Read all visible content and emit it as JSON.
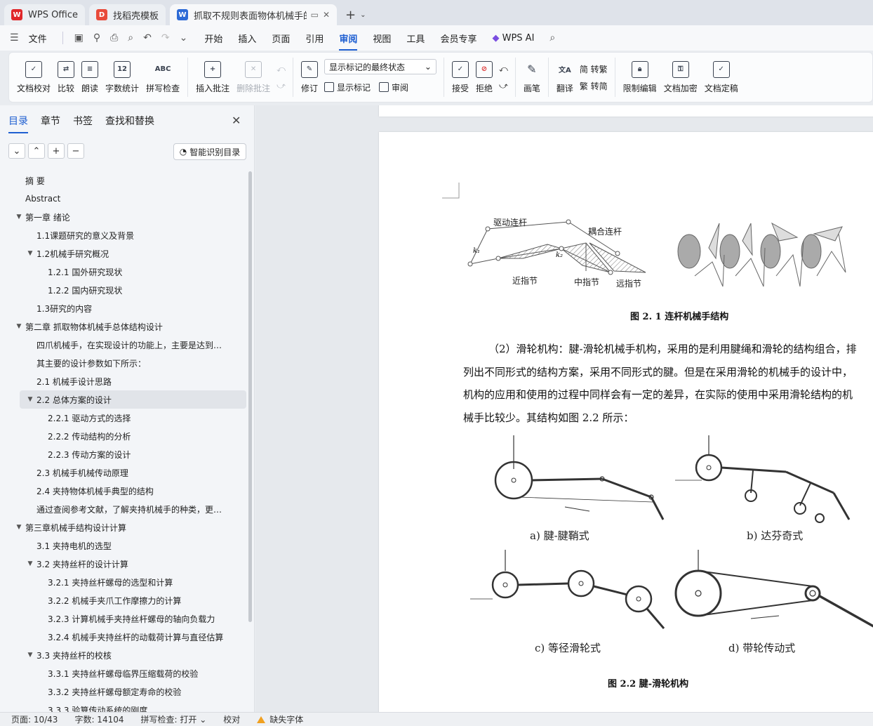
{
  "tabs": [
    {
      "label": "WPS Office",
      "active": false
    },
    {
      "label": "找稻壳模板",
      "active": false
    },
    {
      "label": "抓取不规则表面物体机械手的设计",
      "active": true
    }
  ],
  "menu": {
    "file": "文件",
    "items": [
      "开始",
      "插入",
      "页面",
      "引用",
      "审阅",
      "视图",
      "工具",
      "会员专享"
    ],
    "active": "审阅",
    "ai": "WPS AI"
  },
  "ribbon": {
    "proofread": "文档校对",
    "compare": "比较",
    "read_aloud": "朗读",
    "word_count": "字数统计",
    "spell_check": "拼写检查",
    "insert_comment": "插入批注",
    "delete_comment": "删除批注",
    "track_changes": "修订",
    "markup_mode": "显示标记的最终状态",
    "show_markup": "显示标记",
    "review": "审阅",
    "accept": "接受",
    "reject": "拒绝",
    "pen": "画笔",
    "translate": "翻译",
    "to_traditional": "简 转繁",
    "to_simplified": "繁 转简",
    "restrict_edit": "限制编辑",
    "encrypt": "文档加密",
    "finalize": "文档定稿"
  },
  "nav": {
    "tabs": [
      "目录",
      "章节",
      "书签",
      "查找和替换"
    ],
    "smart_toc": "智能识别目录",
    "toc": [
      {
        "text": "摘 要",
        "level": 1,
        "arrow": ""
      },
      {
        "text": "Abstract",
        "level": 1,
        "arrow": ""
      },
      {
        "text": "第一章 绪论",
        "level": 1,
        "arrow": "▼"
      },
      {
        "text": "1.1课题研究的意义及背景",
        "level": 2,
        "arrow": ""
      },
      {
        "text": "1.2机械手研究概况",
        "level": 2,
        "arrow": "▼"
      },
      {
        "text": "1.2.1 国外研究现状",
        "level": 3,
        "arrow": ""
      },
      {
        "text": "1.2.2 国内研究现状",
        "level": 3,
        "arrow": ""
      },
      {
        "text": "1.3研究的内容",
        "level": 2,
        "arrow": ""
      },
      {
        "text": "第二章 抓取物体机械手总体结构设计",
        "level": 1,
        "arrow": "▼"
      },
      {
        "text": "四爪机械手，在实现设计的功能上，主要是达到夹持...",
        "level": 2,
        "arrow": ""
      },
      {
        "text": "其主要的设计参数如下所示：",
        "level": 2,
        "arrow": ""
      },
      {
        "text": "2.1 机械手设计思路",
        "level": 2,
        "arrow": ""
      },
      {
        "text": "2.2 总体方案的设计",
        "level": 2,
        "arrow": "▼",
        "selected": true
      },
      {
        "text": "2.2.1 驱动方式的选择",
        "level": 3,
        "arrow": ""
      },
      {
        "text": "2.2.2 传动结构的分析",
        "level": 3,
        "arrow": ""
      },
      {
        "text": "2.2.3 传动方案的设计",
        "level": 3,
        "arrow": ""
      },
      {
        "text": "2.3 机械手机械传动原理",
        "level": 2,
        "arrow": ""
      },
      {
        "text": "2.4 夹持物体机械手典型的结构",
        "level": 2,
        "arrow": ""
      },
      {
        "text": "通过查阅参考文献，了解夹持机械手的种类，更好的...",
        "level": 2,
        "arrow": ""
      },
      {
        "text": "第三章机械手结构设计计算",
        "level": 1,
        "arrow": "▼"
      },
      {
        "text": "3.1 夹持电机的选型",
        "level": 2,
        "arrow": ""
      },
      {
        "text": "3.2 夹持丝杆的设计计算",
        "level": 2,
        "arrow": "▼"
      },
      {
        "text": "3.2.1 夹持丝杆螺母的选型和计算",
        "level": 3,
        "arrow": ""
      },
      {
        "text": "3.2.2 机械手夹爪工作摩擦力的计算",
        "level": 3,
        "arrow": ""
      },
      {
        "text": "3.2.3 计算机械手夹持丝杆螺母的轴向负载力",
        "level": 3,
        "arrow": ""
      },
      {
        "text": "3.2.4 机械手夹持丝杆的动载荷计算与直径估算",
        "level": 3,
        "arrow": ""
      },
      {
        "text": "3.3  夹持丝杆的校核",
        "level": 2,
        "arrow": "▼"
      },
      {
        "text": "3.3.1 夹持丝杆螺母临界压缩载荷的校验",
        "level": 3,
        "arrow": ""
      },
      {
        "text": "3.3.2 夹持丝杆螺母额定寿命的校验",
        "level": 3,
        "arrow": ""
      },
      {
        "text": "3.3.3 验算传动系统的刚度",
        "level": 3,
        "arrow": ""
      }
    ]
  },
  "doc": {
    "fig1": {
      "labels": {
        "drive_link": "驱动连杆",
        "coupling_link": "耦合连杆",
        "proximal": "近指节",
        "middle": "中指节",
        "distal": "远指节",
        "k1": "k₁",
        "k2": "k₂"
      },
      "caption": "图 2. 1  连杆机械手结构"
    },
    "paragraph": [
      "（2）滑轮机构：腱-滑轮机械手机构，采用的是利用腱绳和滑轮的结构组合，排",
      "列出不同形式的结构方案，采用不同形式的腱。但是在采用滑轮的机械手的设计中，",
      "机构的应用和使用的过程中同样会有一定的差异，在实际的使用中采用滑轮结构的机",
      "械手比较少。其结构如图  2.2  所示："
    ],
    "fig2": {
      "sub_a": "a)  腱-腱鞘式",
      "sub_b": "b)  达芬奇式",
      "sub_c": "c)  等径滑轮式",
      "sub_d": "d)  带轮传动式",
      "caption": "图  2.2  腱-滑轮机构"
    }
  },
  "status": {
    "page": "页面: 10/43",
    "words": "字数: 14104",
    "spell": "拼写检查: 打开",
    "proof": "校对",
    "missing_font": "缺失字体"
  }
}
